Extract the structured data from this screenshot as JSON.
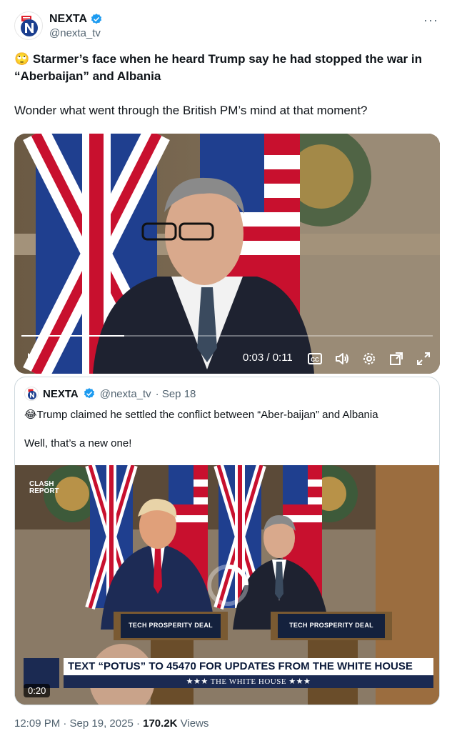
{
  "author": {
    "name": "NEXTA",
    "handle": "@nexta_tv",
    "more_label": "···"
  },
  "tweet": {
    "emoji": "🙄",
    "title": "Starmer’s face when he heard Trump say he had stopped the war in “Aberbaijan” and Albania",
    "body": "Wonder what went through the British PM’s mind at that moment?"
  },
  "video": {
    "time": "0:03 / 0:11",
    "progress": 0.25,
    "icons": [
      "play-icon",
      "captions-icon",
      "volume-icon",
      "settings-icon",
      "pop-out-icon",
      "fullscreen-icon"
    ]
  },
  "quote": {
    "name": "NEXTA",
    "handle": "@nexta_tv",
    "date": "· Sep 18",
    "emoji": "😂",
    "line1": "Trump claimed he settled the conflict between “Aber-baijan” and Albania",
    "line2": "Well, that’s a new one!",
    "media": {
      "overlay_logo_line1": "CLASH",
      "overlay_logo_line2": "REPORT",
      "podium_left": "TECH PROSPERITY DEAL",
      "podium_right": "TECH PROSPERITY DEAL",
      "banner_text": "TEXT “POTUS” TO 45470 FOR UPDATES FROM THE WHITE HOUSE",
      "banner_sub": "★★★  THE WHITE HOUSE  ★★★",
      "duration": "0:20"
    }
  },
  "footer": {
    "time": "12:09 PM · Sep 19, 2025 · ",
    "views_count": "170.2K",
    "views_label": " Views"
  },
  "colors": {
    "verified": "#1d9bf0",
    "nexta_red": "#e0202a",
    "nexta_blue": "#1b3f8f"
  }
}
